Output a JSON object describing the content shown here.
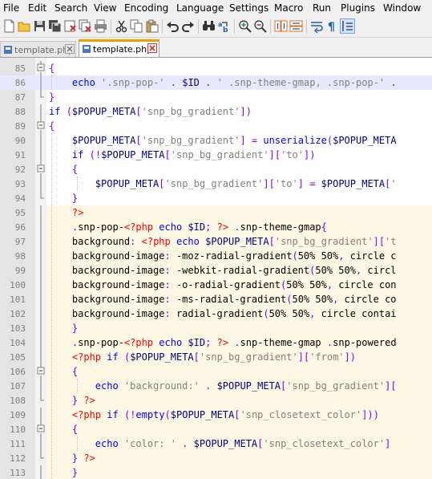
{
  "menu": [
    "File",
    "Edit",
    "Search",
    "View",
    "Encoding",
    "Language",
    "Settings",
    "Macro",
    "Run",
    "Plugins",
    "Window"
  ],
  "toolbar": {
    "icons": [
      "new-file-icon",
      "open-file-icon",
      "save-icon",
      "save-all-icon",
      "close-icon",
      "close-all-icon",
      "print-icon",
      "cut-icon",
      "copy-icon",
      "paste-icon",
      "undo-icon",
      "redo-icon",
      "find-icon",
      "replace-icon",
      "zoom-in-icon",
      "zoom-out-icon",
      "sync-vertical-icon",
      "sync-horizontal-icon",
      "word-wrap-icon",
      "show-all-chars-icon",
      "indent-guide-icon"
    ]
  },
  "tabs": [
    {
      "label": "template.php",
      "active": false
    },
    {
      "label": "template.php",
      "active": true
    }
  ],
  "colors": {
    "keyword": "#0000ff",
    "variable": "#000080",
    "string": "#808080",
    "operator": "#8000ff",
    "php_tag": "#ff0000",
    "line_number": "#808080",
    "php_background": "#fdf8e3",
    "current_line": "#e8e8ff",
    "active_tab_accent": "#f0a000"
  },
  "editor": {
    "lines": [
      {
        "n": "85",
        "text": "{"
      },
      {
        "n": "86",
        "text": "    echo '.snp-pop-' . $ID . ' .snp-theme-gmap, .snp-pop-' ."
      },
      {
        "n": "87",
        "text": "}"
      },
      {
        "n": "88",
        "text": "if ($POPUP_META['snp_bg_gradient'])"
      },
      {
        "n": "89",
        "text": "{"
      },
      {
        "n": "90",
        "text": "    $POPUP_META['snp_bg_gradient'] = unserialize($POPUP_META"
      },
      {
        "n": "91",
        "text": "    if (!$POPUP_META['snp_bg_gradient']['to'])"
      },
      {
        "n": "92",
        "text": "    {"
      },
      {
        "n": "93",
        "text": "        $POPUP_META['snp_bg_gradient']['to'] = $POPUP_META['"
      },
      {
        "n": "94",
        "text": "    }"
      },
      {
        "n": "95",
        "text": "    ?>"
      },
      {
        "n": "96",
        "text": "    .snp-pop-<?php echo $ID; ?> .snp-theme-gmap{"
      },
      {
        "n": "97",
        "text": "    background: <?php echo $POPUP_META['snp_bg_gradient']['t"
      },
      {
        "n": "98",
        "text": "    background-image: -moz-radial-gradient(50% 50%, circle c"
      },
      {
        "n": "99",
        "text": "    background-image: -webkit-radial-gradient(50% 50%, circl"
      },
      {
        "n": "100",
        "text": "    background-image: -o-radial-gradient(50% 50%, circle con"
      },
      {
        "n": "101",
        "text": "    background-image: -ms-radial-gradient(50% 50%, circle co"
      },
      {
        "n": "102",
        "text": "    background-image: radial-gradient(50% 50%, circle contai"
      },
      {
        "n": "103",
        "text": "    }"
      },
      {
        "n": "104",
        "text": "    .snp-pop-<?php echo $ID; ?> .snp-theme-gmap .snp-powered"
      },
      {
        "n": "105",
        "text": "    <?php if ($POPUP_META['snp_bg_gradient']['from'])"
      },
      {
        "n": "106",
        "text": "    {"
      },
      {
        "n": "107",
        "text": "        echo 'background:' . $POPUP_META['snp_bg_gradient']["
      },
      {
        "n": "108",
        "text": "    } ?>"
      },
      {
        "n": "109",
        "text": "    <?php if (!empty($POPUP_META['snp_closetext_color']))"
      },
      {
        "n": "110",
        "text": "    {"
      },
      {
        "n": "111",
        "text": "        echo 'color: ' . $POPUP_META['snp_closetext_color']"
      },
      {
        "n": "112",
        "text": "    } ?>"
      },
      {
        "n": "113",
        "text": "    }"
      }
    ]
  }
}
